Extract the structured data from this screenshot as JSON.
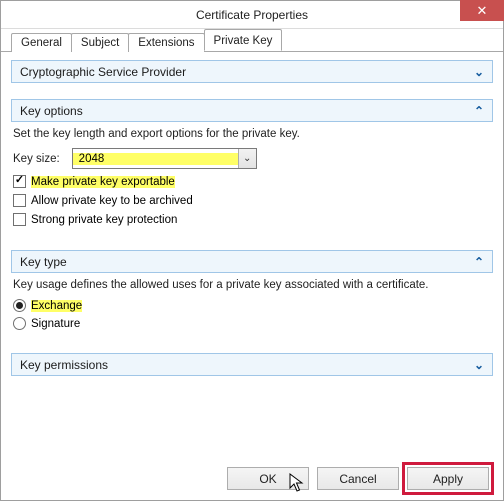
{
  "window": {
    "title": "Certificate Properties",
    "close_icon": "✕"
  },
  "tabs": {
    "general": "General",
    "subject": "Subject",
    "extensions": "Extensions",
    "private_key": "Private Key"
  },
  "panels": {
    "csp": {
      "label": "Cryptographic Service Provider"
    },
    "key_options": {
      "label": "Key options",
      "desc": "Set the key length and export options for the private key.",
      "key_size_label": "Key size:",
      "key_size_value": "2048",
      "cb_exportable": "Make private key exportable",
      "cb_archive": "Allow private key to be archived",
      "cb_strong": "Strong private key protection"
    },
    "key_type": {
      "label": "Key type",
      "desc": "Key usage defines the allowed uses for a private key associated with a certificate.",
      "opt_exchange": "Exchange",
      "opt_signature": "Signature"
    },
    "key_perm": {
      "label": "Key permissions"
    }
  },
  "buttons": {
    "ok": "OK",
    "cancel": "Cancel",
    "apply": "Apply"
  }
}
